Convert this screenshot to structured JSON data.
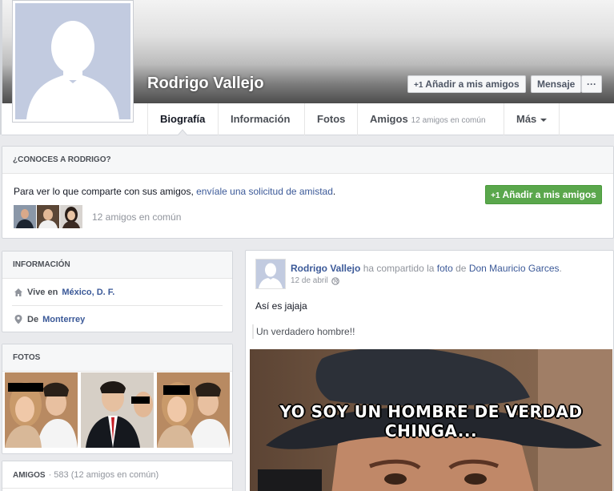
{
  "profile": {
    "name": "Rodrigo Vallejo",
    "add_friend_label": "Añadir a mis amigos",
    "message_label": "Mensaje",
    "more_label": "···"
  },
  "tabs": [
    {
      "label": "Biografía"
    },
    {
      "label": "Información"
    },
    {
      "label": "Fotos"
    },
    {
      "label": "Amigos",
      "sub": "12 amigos en común"
    },
    {
      "label": "Más"
    }
  ],
  "know_box": {
    "title": "¿CONOCES A RODRIGO?",
    "text_prefix": "Para ver lo que comparte con sus amigos, ",
    "text_link": "envíale una solicitud de amistad",
    "text_suffix": ".",
    "button_label": "Añadir a mis amigos",
    "mutual_count": "12 amigos en común"
  },
  "info_box": {
    "title": "INFORMACIÓN",
    "lives_prefix": "Vive en",
    "lives_place": "México, D. F.",
    "from_prefix": "De",
    "from_place": "Monterrey"
  },
  "photos_box": {
    "title": "FOTOS"
  },
  "friends_box": {
    "title": "AMIGOS",
    "count": "· 583 (12 amigos en común)"
  },
  "post": {
    "author": "Rodrigo Vallejo",
    "shared_text": "ha compartido la",
    "photo_word": "foto",
    "of_word": "de",
    "source": "Don Mauricio Garces",
    "period": ".",
    "date": "12 de abril",
    "text": "Así es jajaja",
    "quote": "Un verdadero hombre!!",
    "meme_caption": "YO SOY UN HOMBRE DE VERDAD CHINGA..."
  },
  "colors": {
    "link": "#3b5998",
    "green_button": "#5aa74c",
    "placeholder_avatar": "#c2cbe0"
  },
  "icons": [
    "add-friend-icon",
    "house-icon",
    "location-pin-icon",
    "globe-icon",
    "caret-down-icon"
  ]
}
